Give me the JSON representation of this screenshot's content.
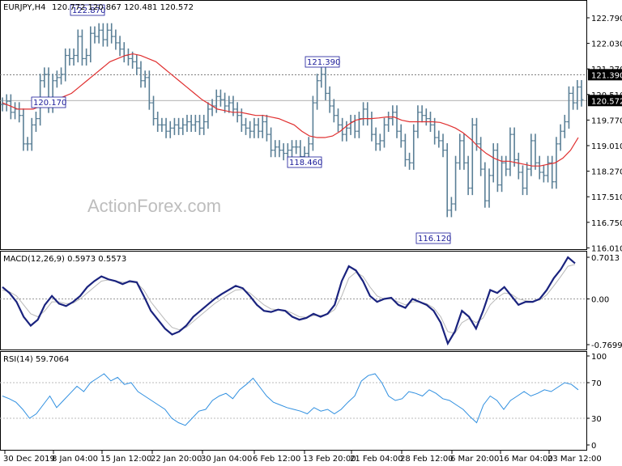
{
  "chart_data": [
    {
      "type": "candlestick",
      "panel": "price",
      "title": "EURJPY,H4",
      "ohlc_text": "120.772 120.867 120.481 120.572",
      "watermark": "ActionForex.com",
      "ylim": [
        116.02,
        123.55
      ],
      "yticks": [
        "122.790",
        "122.030",
        "121.270",
        "120.510",
        "119.770",
        "119.010",
        "118.270",
        "117.510",
        "116.750",
        "116.010"
      ],
      "current_price": "120.572",
      "level_label": "121.390",
      "level_value": 121.39,
      "colors": {
        "bars": "#5a7f96",
        "ma": "#e03030",
        "level_line": "#777777",
        "annotation": "#1a1a99"
      },
      "annotations": [
        {
          "label": "120.170",
          "value": 120.17
        },
        {
          "label": "122.870",
          "value": 122.87
        },
        {
          "label": "121.390",
          "value": 121.39
        },
        {
          "label": "118.460",
          "value": 118.46
        },
        {
          "label": "116.120",
          "value": 116.12
        }
      ],
      "close_series": [
        120.45,
        120.55,
        120.2,
        120.3,
        120.1,
        119.2,
        119.2,
        119.8,
        120.0,
        121.2,
        121.4,
        120.4,
        121.2,
        121.3,
        121.4,
        122.0,
        121.9,
        122.0,
        122.6,
        121.9,
        122.0,
        122.7,
        122.6,
        122.8,
        122.5,
        122.8,
        122.6,
        122.4,
        122.2,
        122.0,
        121.9,
        121.8,
        121.6,
        121.2,
        121.3,
        120.5,
        120.0,
        119.8,
        119.8,
        119.6,
        119.7,
        119.8,
        119.7,
        119.8,
        119.9,
        119.8,
        119.9,
        119.7,
        119.9,
        120.3,
        120.4,
        120.7,
        120.6,
        120.4,
        120.5,
        120.3,
        120.1,
        119.8,
        119.7,
        119.6,
        119.8,
        119.6,
        119.9,
        119.5,
        119.0,
        119.1,
        119.0,
        118.9,
        119.0,
        119.1,
        119.1,
        118.8,
        118.9,
        119.2,
        120.5,
        121.2,
        121.4,
        120.8,
        120.4,
        120.1,
        119.8,
        119.5,
        119.7,
        119.9,
        119.6,
        120.0,
        120.3,
        120.0,
        119.5,
        119.2,
        119.3,
        119.8,
        120.0,
        120.2,
        119.6,
        119.3,
        118.7,
        118.6,
        119.6,
        120.2,
        120.1,
        120.0,
        119.8,
        119.4,
        119.3,
        119.0,
        117.1,
        117.3,
        118.6,
        119.3,
        118.6,
        117.8,
        119.8,
        119.2,
        118.4,
        117.4,
        118.2,
        119.0,
        117.9,
        118.6,
        118.4,
        119.5,
        118.7,
        118.3,
        117.8,
        118.4,
        119.3,
        118.6,
        118.3,
        118.2,
        118.6,
        118.0,
        119.2,
        119.6,
        119.9,
        120.8,
        120.5,
        121.0,
        120.6
      ],
      "ma_series": [
        120.5,
        120.4,
        120.3,
        120.3,
        120.3,
        120.4,
        120.5,
        120.6,
        120.7,
        120.8,
        121.0,
        121.2,
        121.4,
        121.6,
        121.8,
        121.9,
        122.0,
        122.05,
        122.0,
        121.9,
        121.8,
        121.6,
        121.4,
        121.2,
        121.0,
        120.8,
        120.6,
        120.45,
        120.3,
        120.25,
        120.2,
        120.2,
        120.15,
        120.1,
        120.1,
        120.05,
        120.0,
        119.9,
        119.8,
        119.6,
        119.45,
        119.4,
        119.4,
        119.45,
        119.6,
        119.8,
        119.95,
        120.0,
        120.0,
        120.02,
        120.05,
        120.05,
        119.95,
        119.9,
        119.9,
        119.9,
        119.9,
        119.88,
        119.8,
        119.7,
        119.55,
        119.35,
        119.1,
        118.9,
        118.75,
        118.65,
        118.65,
        118.6,
        118.55,
        118.5,
        118.5,
        118.55,
        118.6,
        118.75,
        119.0,
        119.4
      ],
      "xlabels": [
        "30 Dec 2019",
        "8 Jan 04:00",
        "15 Jan 12:00",
        "22 Jan 20:00",
        "30 Jan 04:00",
        "6 Feb 12:00",
        "13 Feb 20:00",
        "21 Feb 04:00",
        "28 Feb 12:00",
        "6 Mar 20:00",
        "16 Mar 04:00",
        "23 Mar 12:00"
      ]
    },
    {
      "type": "line",
      "panel": "macd",
      "title": "MACD(12,26,9) 0.5973 0.5573",
      "ylim": [
        -0.7699,
        0.7013
      ],
      "yticks": [
        "0.7013",
        "0.00",
        "-0.7699"
      ],
      "colors": {
        "macd": "#1a237e",
        "signal": "#b8b8b8",
        "zero": "#999999"
      },
      "macd_series": [
        0.2,
        0.1,
        -0.05,
        -0.3,
        -0.45,
        -0.35,
        -0.1,
        0.05,
        -0.08,
        -0.12,
        -0.05,
        0.05,
        0.2,
        0.3,
        0.38,
        0.33,
        0.3,
        0.25,
        0.3,
        0.28,
        0.05,
        -0.2,
        -0.35,
        -0.5,
        -0.6,
        -0.55,
        -0.45,
        -0.3,
        -0.2,
        -0.1,
        0.0,
        0.08,
        0.15,
        0.22,
        0.18,
        0.05,
        -0.1,
        -0.2,
        -0.22,
        -0.18,
        -0.2,
        -0.3,
        -0.35,
        -0.32,
        -0.25,
        -0.3,
        -0.25,
        -0.1,
        0.3,
        0.55,
        0.48,
        0.3,
        0.05,
        -0.05,
        0.0,
        0.02,
        -0.1,
        -0.15,
        0.0,
        -0.05,
        -0.1,
        -0.2,
        -0.4,
        -0.75,
        -0.55,
        -0.2,
        -0.3,
        -0.5,
        -0.2,
        0.15,
        0.1,
        0.2,
        0.05,
        -0.1,
        -0.05,
        -0.05,
        0.0,
        0.15,
        0.35,
        0.5,
        0.7,
        0.6
      ],
      "signal_series": [
        0.15,
        0.12,
        0.05,
        -0.1,
        -0.25,
        -0.3,
        -0.2,
        -0.05,
        -0.05,
        -0.08,
        -0.07,
        0.0,
        0.1,
        0.2,
        0.3,
        0.32,
        0.3,
        0.28,
        0.28,
        0.27,
        0.15,
        -0.05,
        -0.2,
        -0.35,
        -0.48,
        -0.52,
        -0.48,
        -0.38,
        -0.28,
        -0.18,
        -0.08,
        0.0,
        0.08,
        0.15,
        0.16,
        0.1,
        0.0,
        -0.1,
        -0.17,
        -0.18,
        -0.19,
        -0.24,
        -0.3,
        -0.31,
        -0.28,
        -0.28,
        -0.26,
        -0.18,
        0.05,
        0.35,
        0.45,
        0.38,
        0.2,
        0.05,
        0.0,
        0.0,
        -0.05,
        -0.1,
        -0.05,
        -0.05,
        -0.08,
        -0.15,
        -0.3,
        -0.55,
        -0.58,
        -0.4,
        -0.33,
        -0.4,
        -0.32,
        -0.1,
        0.02,
        0.1,
        0.08,
        0.0,
        -0.03,
        -0.04,
        -0.02,
        0.07,
        0.22,
        0.38,
        0.55,
        0.58
      ]
    },
    {
      "type": "line",
      "panel": "rsi",
      "title": "RSI(14) 59.7064",
      "ylim": [
        0,
        100
      ],
      "yticks": [
        "100",
        "70",
        "30",
        "0"
      ],
      "levels": [
        70,
        30
      ],
      "colors": {
        "rsi": "#2f8fe0",
        "level": "#bbbbbb"
      },
      "rsi_series": [
        55,
        52,
        48,
        40,
        30,
        35,
        45,
        55,
        42,
        50,
        58,
        66,
        60,
        70,
        75,
        80,
        72,
        76,
        68,
        70,
        60,
        55,
        50,
        45,
        40,
        30,
        25,
        22,
        30,
        38,
        40,
        50,
        55,
        58,
        52,
        62,
        68,
        75,
        65,
        55,
        48,
        45,
        42,
        40,
        38,
        35,
        42,
        38,
        40,
        35,
        40,
        48,
        55,
        72,
        78,
        80,
        70,
        55,
        50,
        52,
        60,
        58,
        55,
        62,
        58,
        52,
        50,
        45,
        40,
        32,
        25,
        45,
        55,
        50,
        40,
        50,
        55,
        60,
        55,
        58,
        62,
        60,
        65,
        70,
        68,
        62
      ]
    }
  ]
}
